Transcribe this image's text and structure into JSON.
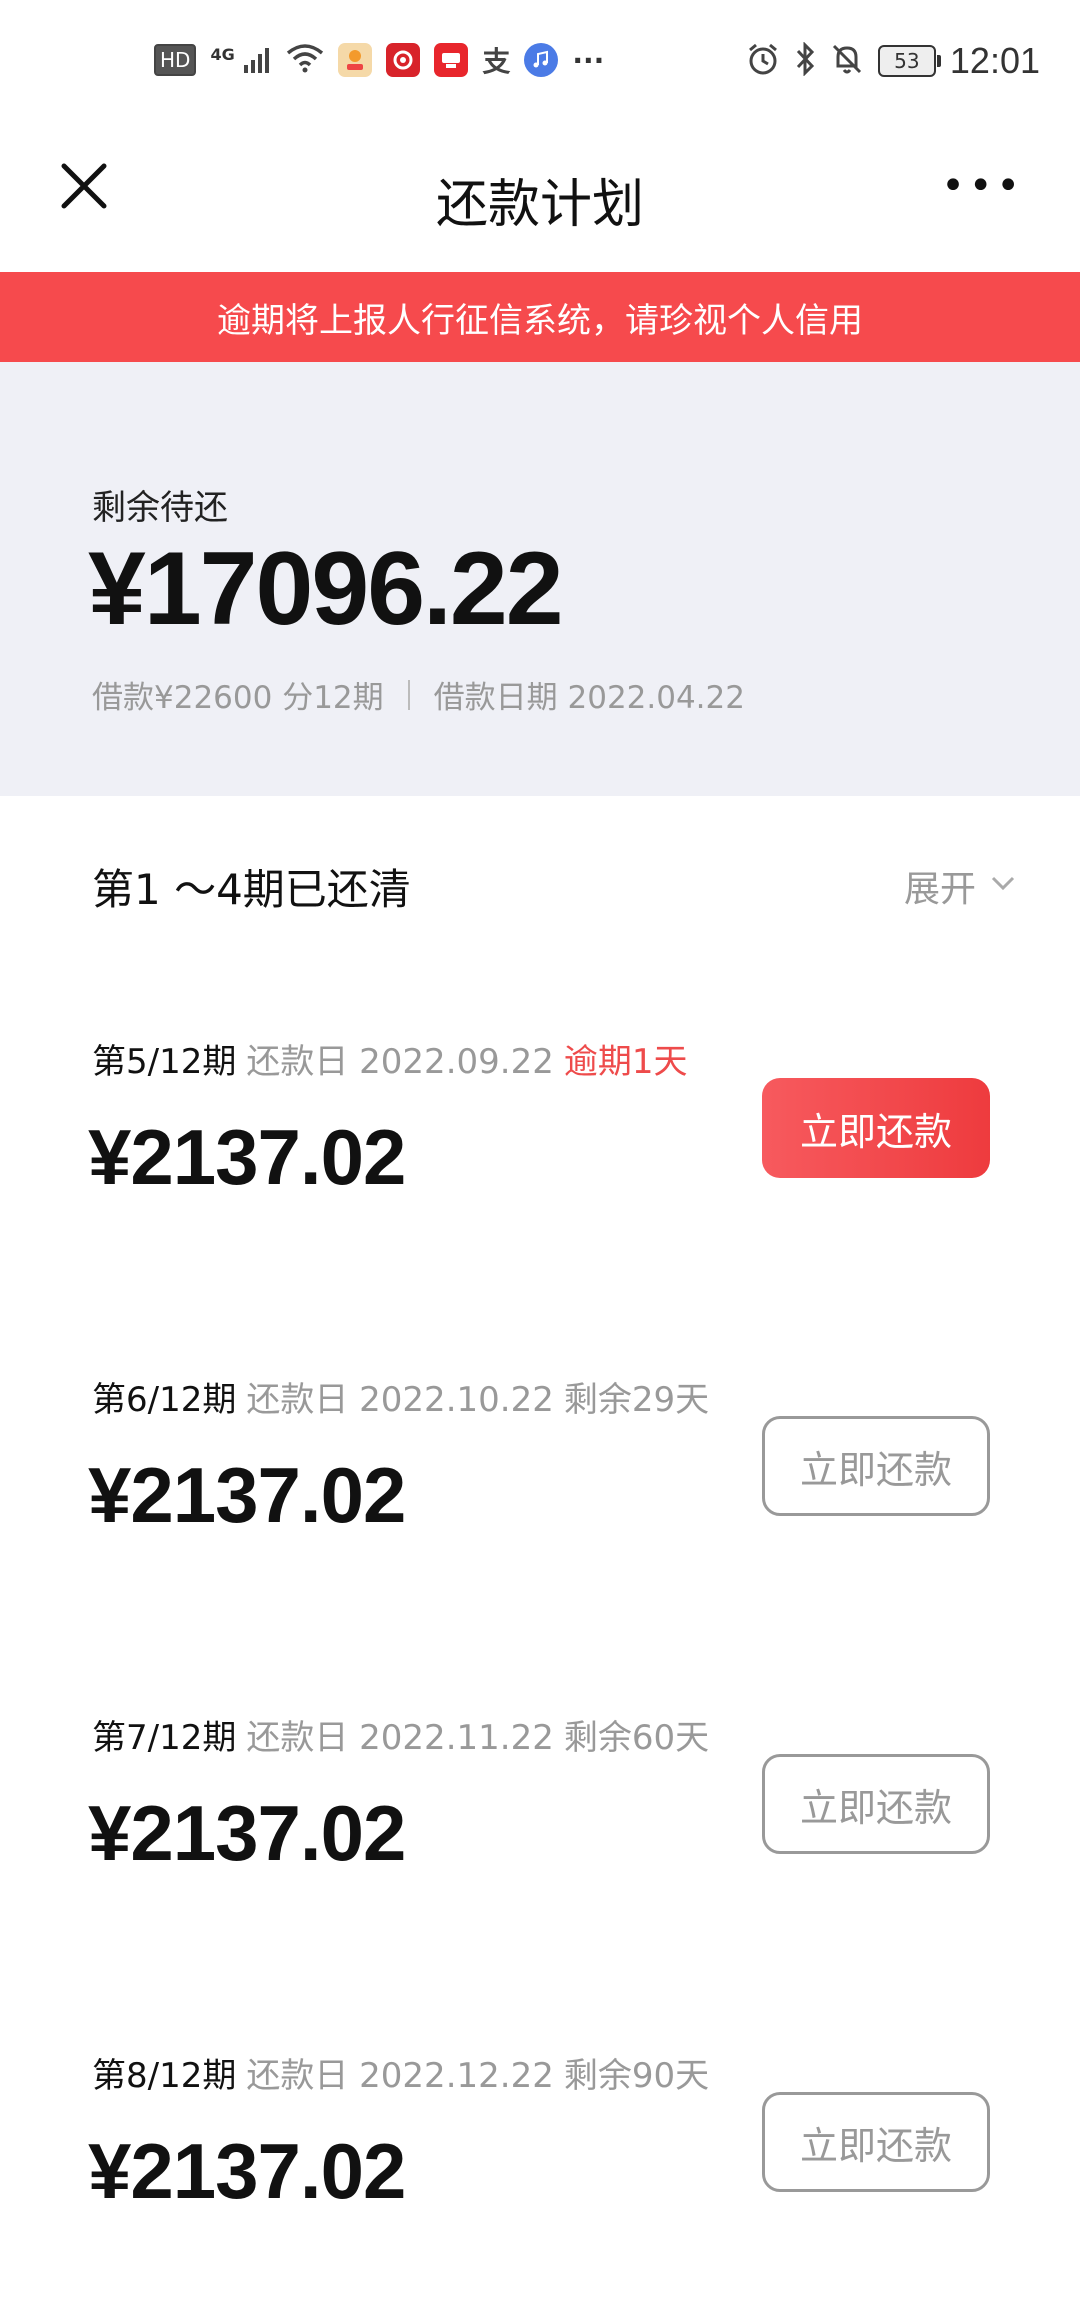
{
  "status_bar": {
    "left_icons": [
      "hd-icon",
      "signal-4g-icon",
      "wifi-icon",
      "app-icon-1",
      "app-icon-2",
      "app-icon-3",
      "alipay-icon",
      "music-icon",
      "more-dots-icon"
    ],
    "hd_label": "HD",
    "net_label": "4G",
    "alipay_char": "支",
    "more": "···",
    "battery": "53",
    "time": "12:01"
  },
  "nav": {
    "title": "还款计划",
    "more": "•••"
  },
  "banner": {
    "text": "逾期将上报人行征信系统，请珍视个人信用"
  },
  "summary": {
    "label": "剩余待还",
    "amount": "¥17096.22",
    "loan_info": "借款¥22600 分12期",
    "loan_date": "借款日期 2022.04.22"
  },
  "paid": {
    "title": "第1 ～4期已还清",
    "expand_label": "展开"
  },
  "installments": [
    {
      "period": "第5/12期",
      "due": "还款日 2022.09.22",
      "remain": "逾期1天",
      "amount": "¥2137.02",
      "button": "立即还款",
      "overdue": true
    },
    {
      "period": "第6/12期",
      "due": "还款日 2022.10.22",
      "remain": "剩余29天",
      "amount": "¥2137.02",
      "button": "立即还款",
      "overdue": false
    },
    {
      "period": "第7/12期",
      "due": "还款日 2022.11.22",
      "remain": "剩余60天",
      "amount": "¥2137.02",
      "button": "立即还款",
      "overdue": false
    },
    {
      "period": "第8/12期",
      "due": "还款日 2022.12.22",
      "remain": "剩余90天",
      "amount": "¥2137.02",
      "button": "立即还款",
      "overdue": false
    }
  ],
  "colors": {
    "banner": "#f64a4d",
    "primary_button": "#ee3b3e",
    "overdue_text": "#ee4b4b",
    "summary_bg": "#eff0f6"
  }
}
